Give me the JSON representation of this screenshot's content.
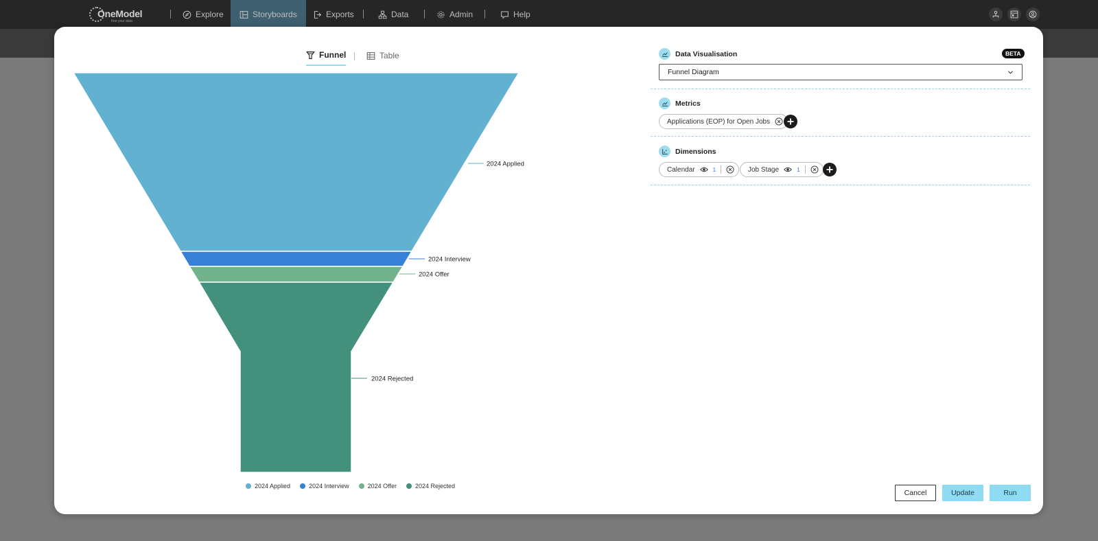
{
  "nav": {
    "logo_text": "OneModel",
    "logo_tagline": "free your data",
    "items": [
      {
        "label": "Explore",
        "icon": "compass-icon"
      },
      {
        "label": "Storyboards",
        "icon": "storyboard-icon",
        "active": true
      },
      {
        "label": "Exports",
        "icon": "export-icon"
      },
      {
        "label": "Data",
        "icon": "data-icon"
      },
      {
        "label": "Admin",
        "icon": "gear-icon"
      },
      {
        "label": "Help",
        "icon": "help-icon"
      }
    ],
    "right_icons": [
      "org-chart-icon",
      "dashboard-icon",
      "user-profile-icon"
    ]
  },
  "viz_tabs": {
    "funnel_label": "Funnel",
    "table_label": "Table",
    "active": "Funnel"
  },
  "chart_data": {
    "type": "funnel",
    "stages": [
      {
        "name": "2024 Applied",
        "color": "#62b1d1"
      },
      {
        "name": "2024 Interview",
        "color": "#3680d8"
      },
      {
        "name": "2024 Offer",
        "color": "#72b28c"
      },
      {
        "name": "2024 Rejected",
        "color": "#43917c"
      }
    ],
    "legend": [
      "2024 Applied",
      "2024 Interview",
      "2024 Offer",
      "2024 Rejected"
    ],
    "legend_placement": "bottom"
  },
  "panel": {
    "data_vis_label": "Data Visualisation",
    "beta_label": "BETA",
    "selected_visualisation": "Funnel Diagram",
    "metrics_label": "Metrics",
    "metric_chips": [
      {
        "label": "Applications (EOP) for Open Jobs"
      }
    ],
    "dimensions_label": "Dimensions",
    "dimension_chips": [
      {
        "label": "Calendar",
        "count": "1"
      },
      {
        "label": "Job Stage",
        "count": "1"
      }
    ]
  },
  "buttons": {
    "cancel": "Cancel",
    "update": "Update",
    "run": "Run"
  },
  "colors": {
    "accent": "#8fdcf2",
    "nav_bg": "#262626",
    "nav_active": "#3d5f70"
  }
}
